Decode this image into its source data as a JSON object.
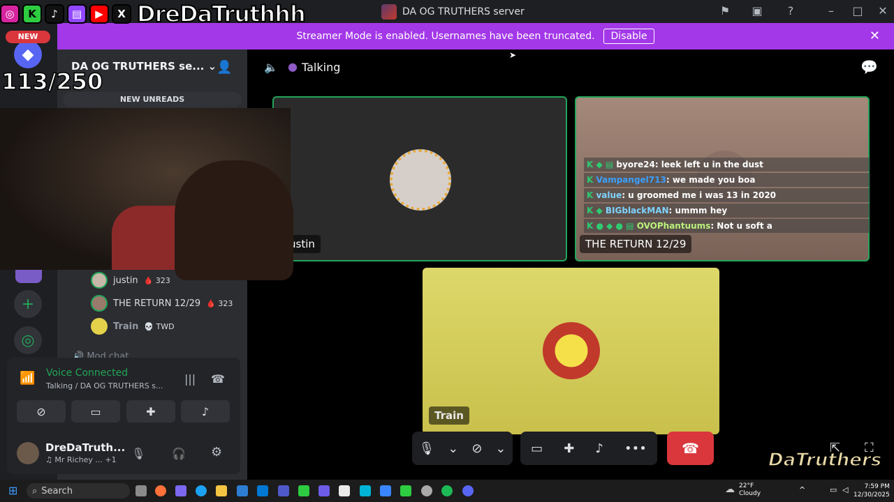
{
  "window": {
    "title": "DA OG TRUTHERS server"
  },
  "banner": {
    "message": "Streamer Mode is enabled. Usernames have been truncated.",
    "disable_label": "Disable"
  },
  "overlay": {
    "handle": "DreDaTruthhh",
    "new_badge": "NEW",
    "goal": "113/250",
    "watermark": "DaTruthers"
  },
  "sidebar": {
    "server_name": "DA OG TRUTHERS se...",
    "new_unreads": "NEW UNREADS",
    "members": [
      {
        "name": "justin",
        "badge": "323"
      },
      {
        "name": "THE RETURN 12/29",
        "badge": "323"
      },
      {
        "name": "Train",
        "badge": "TWD"
      }
    ],
    "next_channel": "Mod chat"
  },
  "voice_panel": {
    "status": "Voice Connected",
    "location": "Talking / DA OG TRUTHERS s..."
  },
  "user": {
    "name": "DreDaTruth...",
    "status": "Mr Richey ...",
    "extra": "+1"
  },
  "main": {
    "channel": "Talking",
    "tiles": [
      {
        "name": "ustin"
      },
      {
        "name": "THE RETURN 12/29"
      },
      {
        "name": "Train"
      }
    ],
    "chat": [
      {
        "user": "byore24",
        "msg": ": leek left u in the dust",
        "color": "#ffffff"
      },
      {
        "user": "Vampangel713",
        "msg": ": we made you boa",
        "color": "#3aa0ff"
      },
      {
        "user": "value",
        "msg": ": u groomed me i was 13 in 2020",
        "color": "#7fd3ff"
      },
      {
        "user": "BIGblackMAN",
        "msg": ": ummm hey",
        "color": "#7fd3ff"
      },
      {
        "user": "OVOPhantuums",
        "msg": ": Not u soft a",
        "color": "#b9f27c"
      }
    ]
  },
  "taskbar": {
    "search": "Search",
    "weather_temp": "22°F",
    "weather_desc": "Cloudy",
    "time": "7:59 PM",
    "date": "12/30/2025"
  },
  "colors": {
    "banner": "#a338e8",
    "green": "#23a559",
    "end_call": "#da373c"
  }
}
